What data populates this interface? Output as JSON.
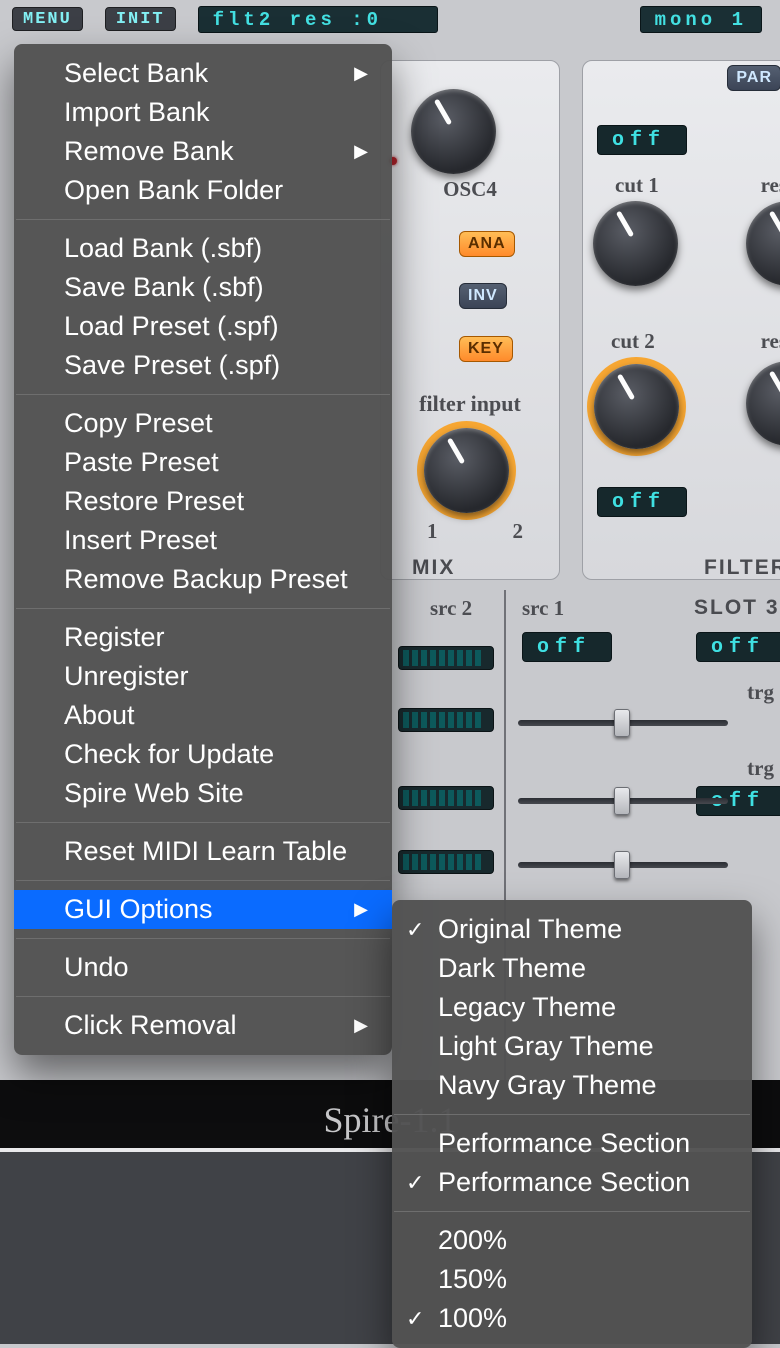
{
  "topbar": {
    "menu": "MENU",
    "init": "INIT",
    "display": "flt2 res    :0",
    "mode": "mono 1"
  },
  "mix_panel": {
    "osc4": "OSC4",
    "ana": "ANA",
    "inv": "INV",
    "key": "KEY",
    "filter_input": "filter input",
    "m1": "1",
    "m2": "2",
    "title": "MIX"
  },
  "filter_panel": {
    "par": "PAR",
    "off1": "off",
    "cut1": "cut 1",
    "res1": "res",
    "cut2": "cut 2",
    "res2": "res",
    "off2": "off",
    "title": "FILTER"
  },
  "mod": {
    "src2": "src 2",
    "src1": "src 1",
    "slot3": "SLOT 3",
    "off": "off",
    "trg": "trg"
  },
  "menu": {
    "g1": [
      "Select Bank",
      "Import Bank",
      "Remove Bank",
      "Open Bank Folder"
    ],
    "g1_arrows": [
      true,
      false,
      true,
      false
    ],
    "g2": [
      "Load Bank (.sbf)",
      "Save Bank (.sbf)",
      "Load Preset (.spf)",
      "Save Preset (.spf)"
    ],
    "g3": [
      "Copy Preset",
      "Paste Preset",
      "Restore Preset",
      "Insert Preset",
      "Remove Backup Preset"
    ],
    "g4": [
      "Register",
      "Unregister",
      "About",
      "Check for Update",
      "Spire Web Site"
    ],
    "g5": [
      "Reset MIDI Learn Table"
    ],
    "g6": [
      "GUI Options"
    ],
    "g7": [
      "Undo"
    ],
    "g8": [
      "Click Removal"
    ]
  },
  "submenu": {
    "themes": [
      "Original Theme",
      "Dark Theme",
      "Legacy Theme",
      "Light Gray Theme",
      "Navy Gray Theme"
    ],
    "theme_checked": 0,
    "perf": [
      "Performance Section",
      "Performance Section"
    ],
    "perf_checked": 1,
    "zoom": [
      "200%",
      "150%",
      "100%"
    ],
    "zoom_checked": 2
  },
  "footer": "Spire-1.1"
}
